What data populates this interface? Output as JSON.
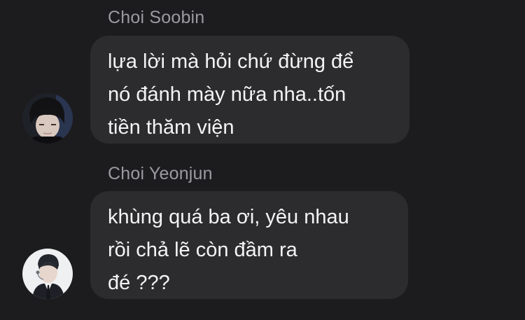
{
  "messages": [
    {
      "sender": "Choi Soobin",
      "lines": [
        "lựa lời mà hỏi chứ đừng để",
        "nó đánh mày nữa nha..tốn",
        "tiền thăm viện"
      ],
      "avatar": "dark-haired-person-avatar"
    },
    {
      "sender": "Choi Yeonjun",
      "lines": [
        "khùng quá ba ơi, yêu nhau",
        "rồi chả lẽ còn đầm ra",
        "đé ???"
      ],
      "avatar": "person-in-suit-with-headset-avatar"
    }
  ],
  "colors": {
    "background": "#1c1c1e",
    "bubble": "#2c2c2e",
    "sender_name": "#9a9aa0",
    "message_text": "#f4f4f6"
  }
}
